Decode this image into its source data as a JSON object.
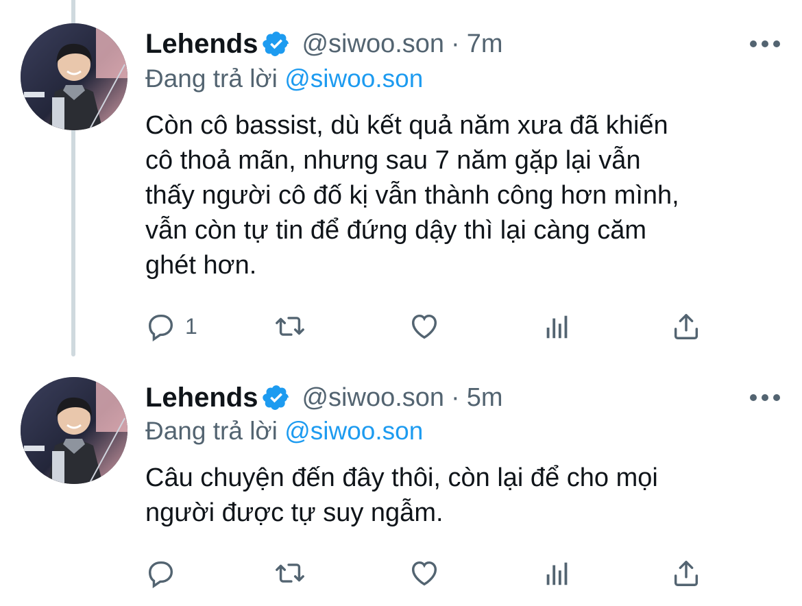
{
  "tweets": [
    {
      "name": "Lehends",
      "handle": "@siwoo.son",
      "separator": "·",
      "time": "7m",
      "reply_prefix": "Đang trả lời",
      "reply_mention": "@siwoo.son",
      "text": "Còn cô bassist, dù kết quả năm xưa đã khiến\ncô thoả mãn, nhưng sau 7 năm gặp lại vẫn\nthấy người cô đố kị vẫn thành công hơn mình,\nvẫn còn tự tin để đứng dậy thì lại càng căm\nghét hơn.",
      "reply_count": "1"
    },
    {
      "name": "Lehends",
      "handle": "@siwoo.son",
      "separator": "·",
      "time": "5m",
      "reply_prefix": "Đang trả lời",
      "reply_mention": "@siwoo.son",
      "text": "Câu chuyện đến đây thôi, còn lại để cho mọi\nngười được tự suy ngẫm.",
      "reply_count": ""
    }
  ],
  "icons": [
    "verified-badge-icon",
    "more-icon",
    "reply-icon",
    "retweet-icon",
    "like-icon",
    "analytics-icon",
    "share-icon"
  ],
  "colors": {
    "accent": "#1d9bf0",
    "text": "#0f1419",
    "secondary": "#536471",
    "thread_line": "#cfd9de"
  }
}
